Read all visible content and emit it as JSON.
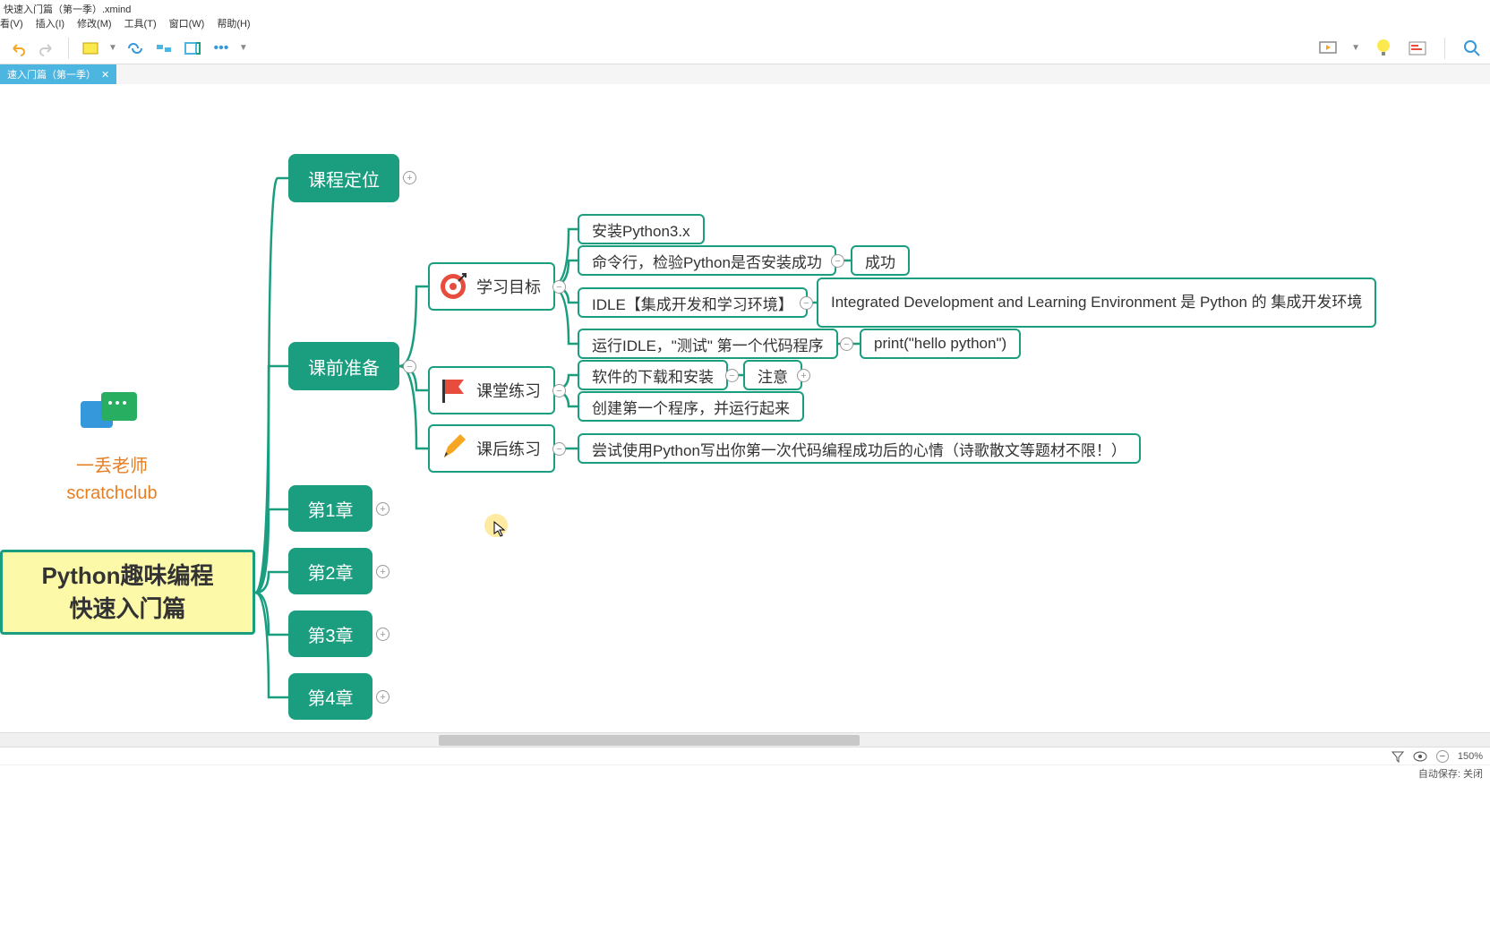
{
  "title": "快速入门篇（第一季）.xmind",
  "menu": {
    "view": "看(V)",
    "insert": "插入(I)",
    "modify": "修改(M)",
    "tools": "工具(T)",
    "window": "窗口(W)",
    "help": "帮助(H)"
  },
  "tab": {
    "label": "速入门篇（第一季）",
    "close": "✕"
  },
  "teacher": {
    "line1": "一丢老师",
    "line2": "scratchclub"
  },
  "root": {
    "line1": "Python趣味编程",
    "line2": "快速入门篇"
  },
  "nodes": {
    "course_pos": "课程定位",
    "pre_prep": "课前准备",
    "ch1": "第1章",
    "ch2": "第2章",
    "ch3": "第3章",
    "ch4": "第4章",
    "goal": "学习目标",
    "class_ex": "课堂练习",
    "after_ex": "课后练习",
    "install": "安装Python3.x",
    "cmd": "命令行，检验Python是否安装成功",
    "success": "成功",
    "idle": "IDLE【集成开发和学习环境】",
    "idle_desc": "Integrated Development and Learning Environment 是 Python 的 集成开发环境",
    "run_idle": "运行IDLE，\"测试\" 第一个代码程序",
    "print": "print(\"hello python\")",
    "download": "软件的下载和安装",
    "note": "注意",
    "create": "创建第一个程序，并运行起来",
    "try": "尝试使用Python写出你第一次代码编程成功后的心情（诗歌散文等题材不限！）"
  },
  "status": {
    "zoom": "150%",
    "autosave": "自动保存: 关闭"
  }
}
